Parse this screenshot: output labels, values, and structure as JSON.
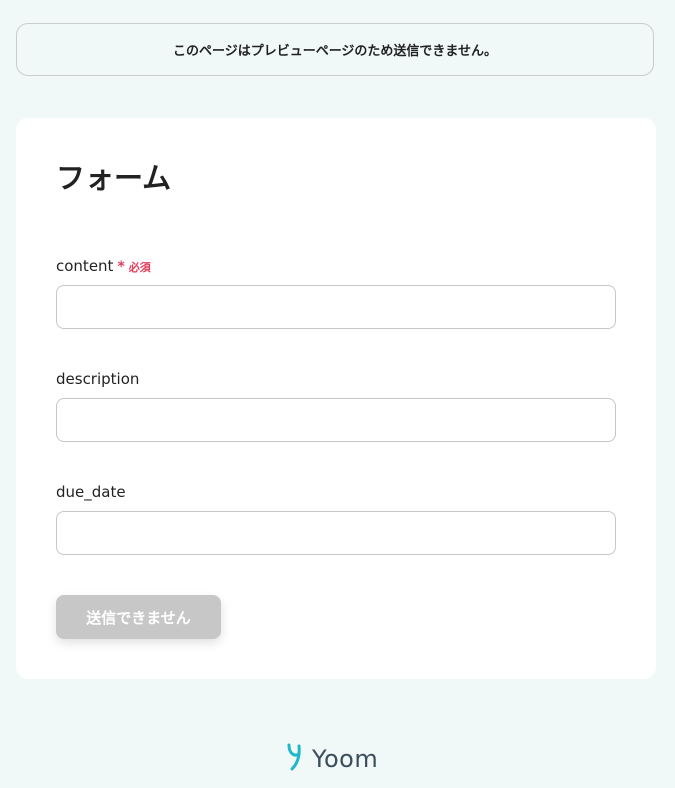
{
  "notice": {
    "text": "このページはプレビューページのため送信できません。"
  },
  "form": {
    "title": "フォーム",
    "fields": [
      {
        "label": "content",
        "required_mark": "*",
        "required_text": "必須",
        "value": ""
      },
      {
        "label": "description",
        "value": ""
      },
      {
        "label": "due_date",
        "value": ""
      }
    ],
    "submit_label": "送信できません"
  },
  "footer": {
    "logo_text": "Yoom",
    "logo_icon": "yoom-logo-icon"
  },
  "colors": {
    "background": "#f1f8f8",
    "required": "#e23d5b",
    "button_disabled": "#c7c7c7",
    "logo_accent": "#1fb8c8"
  }
}
